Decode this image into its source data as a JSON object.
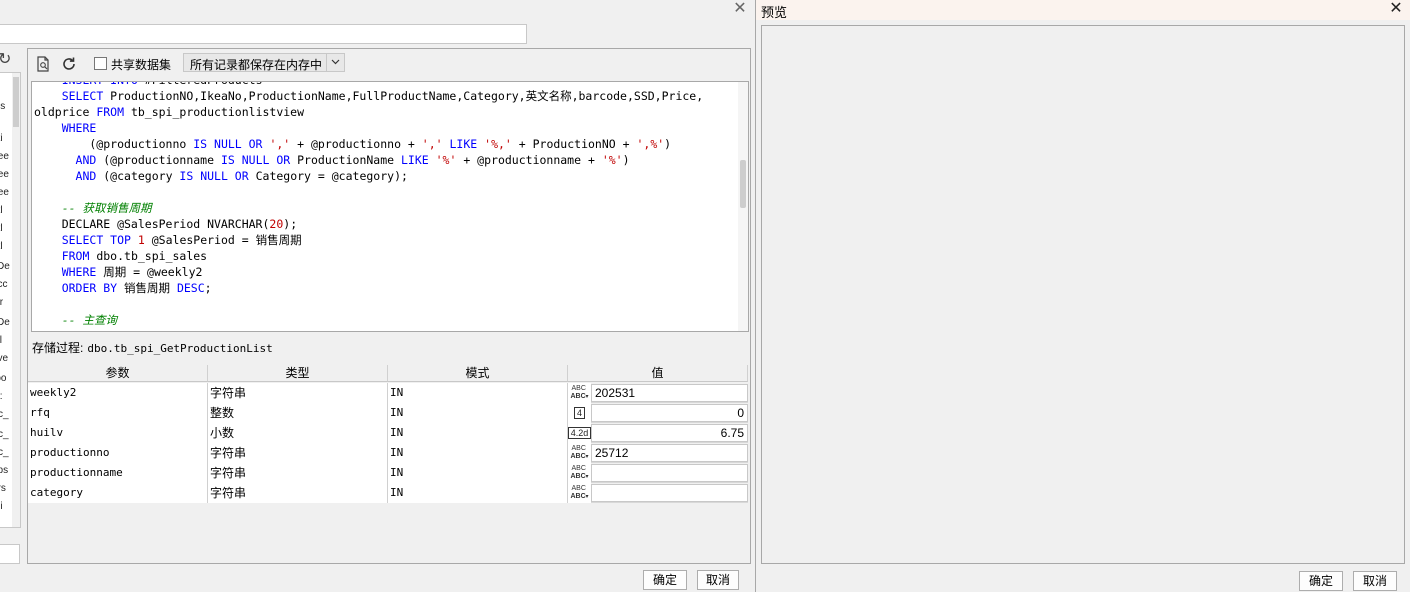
{
  "left_dialog": {
    "close_glyph": "✕",
    "toolbar": {
      "share_dataset_label": "共享数据集",
      "memory_mode_selected": "所有记录都保存在内存中"
    },
    "left_strip_fragments": [
      "ls",
      "ati",
      "Yee",
      "Yee",
      "Yee",
      "atl",
      "atl",
      "atl",
      "sDe",
      "_cc",
      "str",
      "zDe",
      "tyl",
      "ave",
      "roo",
      "ty:",
      "c_",
      "c_",
      "c_",
      "_ps",
      "ors",
      "rsi"
    ],
    "code_lines": [
      [
        [
          "    ",
          ""
        ],
        [
          "INSERT INTO",
          "kw"
        ],
        [
          " #FilteredProducts",
          ""
        ]
      ],
      [
        [
          "    ",
          ""
        ],
        [
          "SELECT",
          "kw"
        ],
        [
          " ProductionNO,IkeaNo,ProductionName,FullProductName,Category,英文名称,barcode,SSD,Price,",
          ""
        ]
      ],
      [
        [
          "oldprice ",
          ""
        ],
        [
          "FROM",
          "kw"
        ],
        [
          " tb_spi_productionlistview",
          ""
        ]
      ],
      [
        [
          "    ",
          ""
        ],
        [
          "WHERE",
          "kw"
        ]
      ],
      [
        [
          "        (@productionno ",
          ""
        ],
        [
          "IS NULL OR",
          "kw"
        ],
        [
          " ",
          ""
        ],
        [
          "','",
          "str"
        ],
        [
          " + @productionno + ",
          ""
        ],
        [
          "','",
          "str"
        ],
        [
          " ",
          ""
        ],
        [
          "LIKE",
          "kw"
        ],
        [
          " ",
          ""
        ],
        [
          "'%,'",
          "str"
        ],
        [
          " + ProductionNO + ",
          ""
        ],
        [
          "',%'",
          "str"
        ],
        [
          ")",
          ""
        ]
      ],
      [
        [
          "      ",
          ""
        ],
        [
          "AND",
          "kw"
        ],
        [
          " (@productionname ",
          ""
        ],
        [
          "IS NULL OR",
          "kw"
        ],
        [
          " ProductionName ",
          ""
        ],
        [
          "LIKE",
          "kw"
        ],
        [
          " ",
          ""
        ],
        [
          "'%'",
          "str"
        ],
        [
          " + @productionname + ",
          ""
        ],
        [
          "'%'",
          "str"
        ],
        [
          ")",
          ""
        ]
      ],
      [
        [
          "      ",
          ""
        ],
        [
          "AND",
          "kw"
        ],
        [
          " (@category ",
          ""
        ],
        [
          "IS NULL OR",
          "kw"
        ],
        [
          " Category = @category);",
          ""
        ]
      ],
      [
        [
          "",
          ""
        ]
      ],
      [
        [
          "    ",
          ""
        ],
        [
          "-- 获取销售周期",
          "cm"
        ]
      ],
      [
        [
          "    DECLARE @SalesPeriod NVARCHAR(",
          ""
        ],
        [
          "20",
          "num"
        ],
        [
          ");",
          ""
        ]
      ],
      [
        [
          "    ",
          ""
        ],
        [
          "SELECT TOP",
          "kw"
        ],
        [
          " ",
          ""
        ],
        [
          "1",
          "num"
        ],
        [
          " @SalesPeriod = 销售周期",
          ""
        ]
      ],
      [
        [
          "    ",
          ""
        ],
        [
          "FROM",
          "kw"
        ],
        [
          " dbo.tb_spi_sales",
          ""
        ]
      ],
      [
        [
          "    ",
          ""
        ],
        [
          "WHERE",
          "kw"
        ],
        [
          " 周期 = @weekly2",
          ""
        ]
      ],
      [
        [
          "    ",
          ""
        ],
        [
          "ORDER BY",
          "kw"
        ],
        [
          " 销售周期 ",
          ""
        ],
        [
          "DESC",
          "kw"
        ],
        [
          ";",
          ""
        ]
      ],
      [
        [
          "",
          ""
        ]
      ],
      [
        [
          "    ",
          ""
        ],
        [
          "-- 主查询",
          "cm"
        ]
      ]
    ],
    "stored_procedure": {
      "label": "存储过程:",
      "name": "dbo.tb_spi_GetProductionList"
    },
    "param_table": {
      "headers": [
        "参数",
        "类型",
        "模式",
        "值"
      ],
      "rows": [
        {
          "name": "weekly2",
          "type": "字符串",
          "mode": "IN",
          "icon": "abc-icon",
          "value": "202531",
          "align": "left"
        },
        {
          "name": "rfq",
          "type": "整数",
          "mode": "IN",
          "icon": "int-icon",
          "icon_text": "4",
          "value": "0",
          "align": "right"
        },
        {
          "name": "huilv",
          "type": "小数",
          "mode": "IN",
          "icon": "decimal-icon",
          "icon_text": "4.2d",
          "value": "6.75",
          "align": "right"
        },
        {
          "name": "productionno",
          "type": "字符串",
          "mode": "IN",
          "icon": "abc-icon",
          "value": "25712",
          "align": "left"
        },
        {
          "name": "productionname",
          "type": "字符串",
          "mode": "IN",
          "icon": "abc-icon",
          "value": "",
          "align": "left"
        },
        {
          "name": "category",
          "type": "字符串",
          "mode": "IN",
          "icon": "abc-icon",
          "value": "",
          "align": "left"
        }
      ]
    },
    "ok_label": "确定",
    "cancel_label": "取消"
  },
  "preview": {
    "title": "预览",
    "close_glyph": "✕",
    "ok_label": "确定",
    "cancel_label": "取消"
  }
}
